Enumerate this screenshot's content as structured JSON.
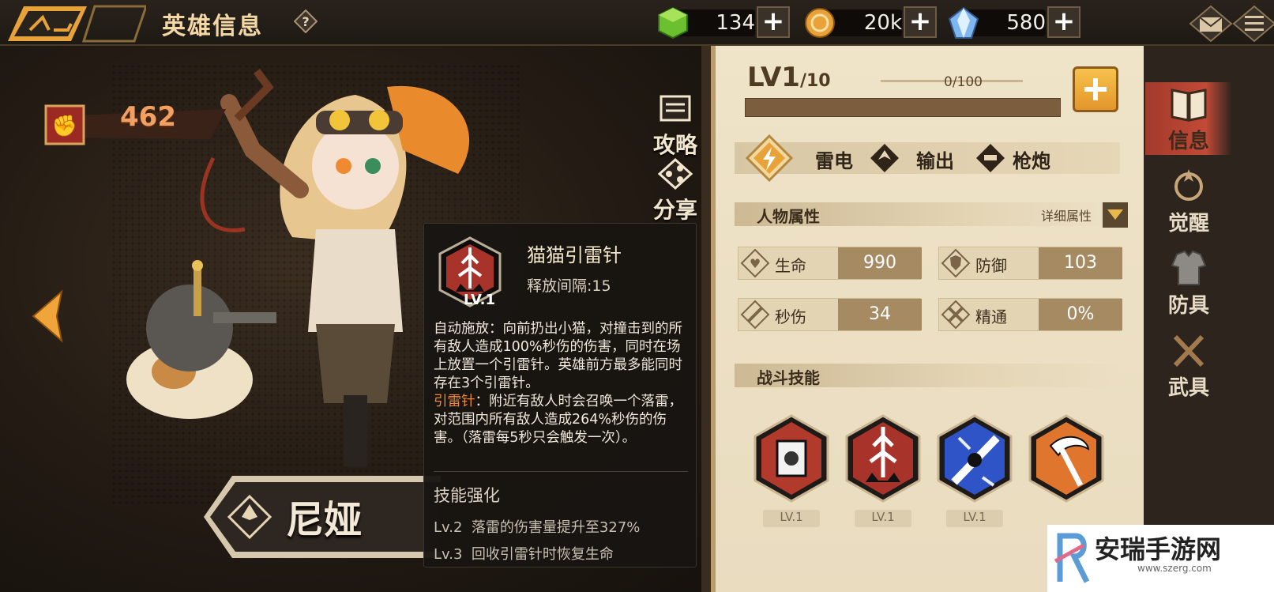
{
  "header": {
    "title": "英雄信息",
    "help_icon": "help-icon"
  },
  "resources": [
    {
      "name": "energy",
      "icon": "green-cube-icon",
      "value": "134"
    },
    {
      "name": "gold",
      "icon": "gold-coin-icon",
      "value": "20k"
    },
    {
      "name": "crystal",
      "icon": "crystal-icon",
      "value": "580"
    }
  ],
  "hero": {
    "power": "462",
    "name": "尼娅",
    "actions": {
      "guide": "攻略",
      "share": "分享"
    }
  },
  "tooltip": {
    "skill_name": "猫猫引雷针",
    "level": "LV.1",
    "cooldown": "释放间隔:15",
    "desc_main": "自动施放：向前扔出小猫，对撞击到的所有敌人造成100%秒伤的伤害，同时在场上放置一个引雷针。英雄前方最多能同时存在3个引雷针。",
    "desc_hl": "引雷针",
    "desc_sub": "：附近有敌人时会召唤一个落雷，对范围内所有敌人造成264%秒伤的伤害。（落雷每5秒只会触发一次）。",
    "enhance_title": "技能强化",
    "enhancements": [
      {
        "lv": "Lv.2",
        "text": "落雷的伤害量提升至327%"
      },
      {
        "lv": "Lv.3",
        "text": "回收引雷针时恢复生命"
      }
    ]
  },
  "panel": {
    "level_main": "LV1",
    "level_max": "/10",
    "exp_text": "0/100",
    "exp_progress": 0,
    "tags": [
      "雷电",
      "输出",
      "枪炮"
    ],
    "attr_title": "人物属性",
    "detail_label": "详细属性",
    "stats": [
      {
        "label": "生命",
        "value": "990",
        "icon": "heart-icon"
      },
      {
        "label": "防御",
        "value": "103",
        "icon": "shield-icon"
      },
      {
        "label": "秒伤",
        "value": "34",
        "icon": "sword-icon"
      },
      {
        "label": "精通",
        "value": "0%",
        "icon": "crossed-swords-icon"
      }
    ],
    "skills_title": "战斗技能",
    "skills": [
      {
        "icon": "lightning-rod-device-icon",
        "level": "LV.1"
      },
      {
        "icon": "cat-lightning-rod-icon",
        "level": "LV.1"
      },
      {
        "icon": "paw-lightning-icon",
        "level": "LV.1"
      },
      {
        "icon": "scythe-icon",
        "level": ""
      }
    ]
  },
  "tabs": [
    {
      "label": "信息",
      "icon": "book-icon",
      "active": true
    },
    {
      "label": "觉醒",
      "icon": "awaken-icon",
      "active": false
    },
    {
      "label": "防具",
      "icon": "armor-icon",
      "active": false
    },
    {
      "label": "武具",
      "icon": "weapon-icon",
      "active": false
    }
  ],
  "watermark": {
    "text": "安瑞手游网",
    "url": "www.szerg.com"
  },
  "colors": {
    "accent": "#e8a23a",
    "panel": "#efe3c8",
    "tab_active": "#b8432f",
    "highlight": "#f08a30"
  }
}
